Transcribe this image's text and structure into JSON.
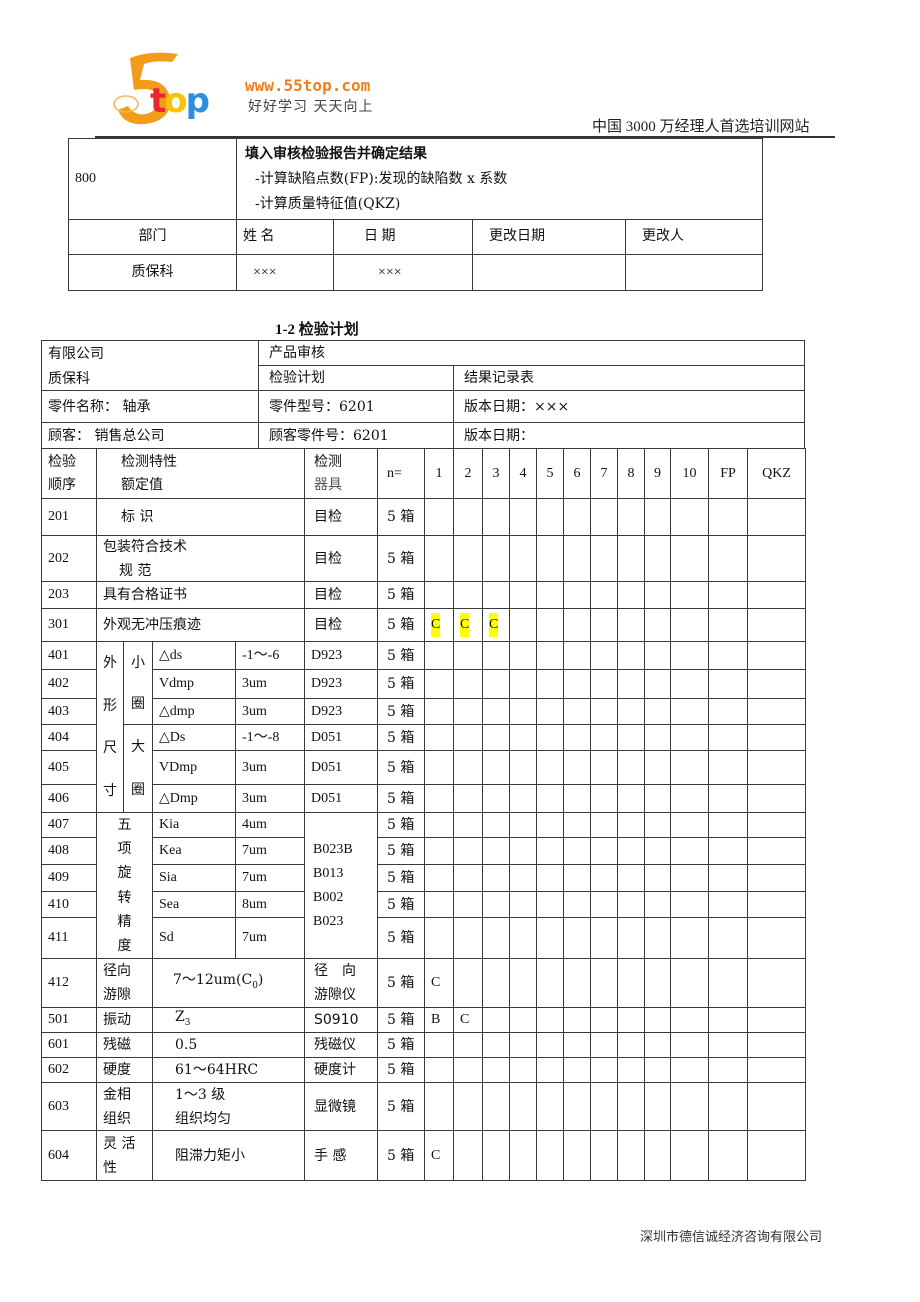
{
  "header": {
    "logo_five": "5",
    "logo_top": [
      "t",
      "o",
      "p"
    ],
    "logo_colors": {
      "five": "#f39c1a",
      "t": "#e8262b",
      "o": "#f7c400",
      "p": "#2b8fe0"
    },
    "logo_url": "www.55top.com",
    "logo_slogan": "好好学习  天天向上",
    "tagline": "中国 3000 万经理人首选培训网站"
  },
  "top_table": {
    "step_code": "800",
    "step_title": "填入审核检验报告并确定结果",
    "step_lines": [
      "-计算缺陷点数(FP):发现的缺陷数 x 系数",
      "-计算质量特征值(QKZ)"
    ],
    "headers": [
      "部门",
      "姓 名",
      "日 期",
      "更改日期",
      "更改人"
    ],
    "row": [
      "质保科",
      "×××",
      "×××",
      "",
      ""
    ]
  },
  "section_title": "1-2 检验计划",
  "plan_header": {
    "company": "有限公司",
    "dept": "质保科",
    "product_audit": "产品审核",
    "inspection_plan": "检验计划",
    "result_record": "结果记录表",
    "part_name": "零件名称：  轴承",
    "part_model": "零件型号：6201",
    "version_date_1": "版本日期：×××",
    "customer": "顾客：  销售总公司",
    "customer_part": "顾客零件号：6201",
    "version_date_2": "版本日期："
  },
  "columns": {
    "seq": [
      "检验",
      "顺序"
    ],
    "characteristic": [
      "检测特性",
      "额定值"
    ],
    "instrument": [
      "检测",
      "器具"
    ],
    "n": "n=",
    "samples": [
      "1",
      "2",
      "3",
      "4",
      "5",
      "6",
      "7",
      "8",
      "9",
      "10"
    ],
    "fp": "FP",
    "qkz": "QKZ"
  },
  "rows": [
    {
      "seq": "201",
      "characteristic": "标 识",
      "instrument": "目检",
      "n": "5 箱",
      "results": []
    },
    {
      "seq": "202",
      "characteristic": "包装符合技术 规 范",
      "instrument": "目检",
      "n": "5 箱",
      "results": []
    },
    {
      "seq": "203",
      "characteristic": "具有合格证书",
      "instrument": "目检",
      "n": "5 箱",
      "results": []
    },
    {
      "seq": "301",
      "characteristic": "外观无冲压痕迹",
      "instrument": "目检",
      "n": "5 箱",
      "results": [
        "C",
        "C",
        "C"
      ],
      "highlight": true
    },
    {
      "seq": "401",
      "group": "外形尺寸",
      "subgroup": "小圈",
      "param": "△ds",
      "spec": "-1～-6",
      "instrument": "D923",
      "n": "5 箱",
      "results": []
    },
    {
      "seq": "402",
      "group": "外形尺寸",
      "subgroup": "小圈",
      "param": "Vdmp",
      "spec": "3um",
      "instrument": "D923",
      "n": "5 箱",
      "results": []
    },
    {
      "seq": "403",
      "group": "外形尺寸",
      "subgroup": "小圈",
      "param": "△dmp",
      "spec": "3um",
      "instrument": "D923",
      "n": "5 箱",
      "results": []
    },
    {
      "seq": "404",
      "group": "外形尺寸",
      "subgroup": "大圈",
      "param": "△Ds",
      "spec": "-1～-8",
      "instrument": "D051",
      "n": "5 箱",
      "results": []
    },
    {
      "seq": "405",
      "group": "外形尺寸",
      "subgroup": "大圈",
      "param": "VDmp",
      "spec": "3um",
      "instrument": "D051",
      "n": "5 箱",
      "results": []
    },
    {
      "seq": "406",
      "group": "外形尺寸",
      "subgroup": "大圈",
      "param": "△Dmp",
      "spec": "3um",
      "instrument": "D051",
      "n": "5 箱",
      "results": []
    },
    {
      "seq": "407",
      "group": "五项旋转精度",
      "param": "Kia",
      "spec": "4um",
      "instrument": "B023B B013 B002 B023",
      "n": "5 箱",
      "results": []
    },
    {
      "seq": "408",
      "group": "五项旋转精度",
      "param": "Kea",
      "spec": "7um",
      "instrument": "B023B B013 B002 B023",
      "n": "5 箱",
      "results": []
    },
    {
      "seq": "409",
      "group": "五项旋转精度",
      "param": "Sia",
      "spec": "7um",
      "instrument": "B023B B013 B002 B023",
      "n": "5 箱",
      "results": []
    },
    {
      "seq": "410",
      "group": "五项旋转精度",
      "param": "Sea",
      "spec": "8um",
      "instrument": "B023B B013 B002 B023",
      "n": "5 箱",
      "results": []
    },
    {
      "seq": "411",
      "group": "五项旋转精度",
      "param": "Sd",
      "spec": "7um",
      "instrument": "B023B B013 B002 B023",
      "n": "5 箱",
      "results": []
    },
    {
      "seq": "412",
      "name": "径向游隙",
      "spec": "7～12um(C0)",
      "instrument": "径 向 游隙仪",
      "n": "5 箱",
      "results": [
        "C"
      ]
    },
    {
      "seq": "501",
      "name": "振动",
      "spec": "Z3",
      "instrument": "S0910",
      "n": "5 箱",
      "results": [
        "B",
        "C"
      ]
    },
    {
      "seq": "601",
      "name": "残磁",
      "spec": "0.5",
      "instrument": "残磁仪",
      "n": "5 箱",
      "results": []
    },
    {
      "seq": "602",
      "name": "硬度",
      "spec": "61～64HRC",
      "instrument": "硬度计",
      "n": "5 箱",
      "results": []
    },
    {
      "seq": "603",
      "name": "金相组织",
      "spec": "1～3 级 组织均匀",
      "instrument": "显微镜",
      "n": "5 箱",
      "results": []
    },
    {
      "seq": "604",
      "name": "灵 活 性",
      "spec": "阻滞力矩小",
      "instrument": "手 感",
      "n": "5 箱",
      "results": [
        "C"
      ]
    }
  ],
  "labels": {
    "group_outer": [
      "外",
      "形",
      "尺",
      "寸"
    ],
    "sub_small": [
      "小",
      "圈"
    ],
    "sub_large": [
      "大",
      "圈"
    ],
    "group_rot": [
      "五",
      "项",
      "旋",
      "转",
      "精",
      "度"
    ],
    "inst_rot": [
      "B023B",
      "B013",
      "B002",
      "B023"
    ],
    "r202": [
      "包装符合技术",
      "规 范"
    ],
    "r412_name": [
      "径向",
      "游隙"
    ],
    "r412_spec_main": "7～12um(C",
    "r412_spec_sub": "0",
    "r412_spec_end": ")",
    "r412_inst": [
      "径　向",
      "游隙仪"
    ],
    "r501_spec_main": "Z",
    "r501_spec_sub": "3",
    "r603_name": [
      "金相",
      "组织"
    ],
    "r603_spec": [
      "1～3 级",
      "组织均匀"
    ],
    "r604_name": [
      "灵 活",
      "性"
    ]
  },
  "highlight_color": "#ffff00",
  "footer": "深圳市德信诚经济咨询有限公司"
}
